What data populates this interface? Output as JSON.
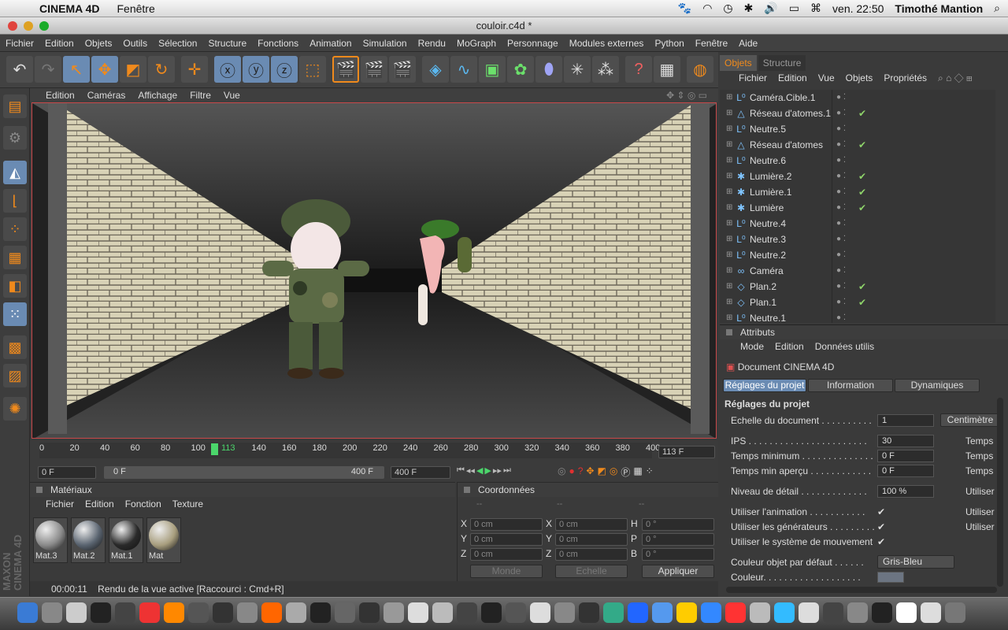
{
  "menubar": {
    "app_name": "CINEMA 4D",
    "menu": "Fenêtre",
    "time": "ven. 22:50",
    "user": "Timothé Mantion"
  },
  "window": {
    "title": "couloir.c4d *"
  },
  "main_menu": [
    "Fichier",
    "Edition",
    "Objets",
    "Outils",
    "Sélection",
    "Structure",
    "Fonctions",
    "Animation",
    "Simulation",
    "Rendu",
    "MoGraph",
    "Personnage",
    "Modules externes",
    "Python",
    "Fenêtre",
    "Aide"
  ],
  "viewport_menu": [
    "Edition",
    "Caméras",
    "Affichage",
    "Filtre",
    "Vue"
  ],
  "timeline": {
    "ticks": [
      "0",
      "20",
      "40",
      "60",
      "80",
      "100",
      "113",
      "140",
      "160",
      "180",
      "200",
      "220",
      "240",
      "260",
      "280",
      "300",
      "320",
      "340",
      "360",
      "380",
      "400"
    ],
    "current_frame": "113 F",
    "start": "0 F",
    "range_start": "0 F",
    "range_end": "400 F",
    "end": "400 F"
  },
  "materials": {
    "title": "Matériaux",
    "menu": [
      "Fichier",
      "Edition",
      "Fonction",
      "Texture"
    ],
    "items": [
      {
        "name": "Mat.3",
        "color": "#8a8a8a"
      },
      {
        "name": "Mat.2",
        "color": "#5a6470"
      },
      {
        "name": "Mat.1",
        "color": "#2a2a2a"
      },
      {
        "name": "Mat",
        "color": "#a89e7e"
      }
    ]
  },
  "coords": {
    "title": "Coordonnées",
    "col_headers": [
      "--",
      "--",
      "--"
    ],
    "rows": [
      {
        "a": "X",
        "av": "0 cm",
        "b": "X",
        "bv": "0 cm",
        "c": "H",
        "cv": "0 °"
      },
      {
        "a": "Y",
        "av": "0 cm",
        "b": "Y",
        "bv": "0 cm",
        "c": "P",
        "cv": "0 °"
      },
      {
        "a": "Z",
        "av": "0 cm",
        "b": "Z",
        "bv": "0 cm",
        "c": "B",
        "cv": "0 °"
      }
    ],
    "mode_select": "Monde",
    "scale_select": "Echelle",
    "apply": "Appliquer"
  },
  "status": {
    "time": "00:00:11",
    "message": "Rendu de la vue active [Raccourci : Cmd+R]"
  },
  "objects": {
    "tabs": [
      "Objets",
      "Structure"
    ],
    "menu": [
      "Fichier",
      "Edition",
      "Vue",
      "Objets",
      "Propriétés"
    ],
    "items": [
      {
        "label": "Caméra.Cible.1",
        "icon": "null-icon",
        "glyph": "L⁰",
        "checked": false
      },
      {
        "label": "Réseau d'atomes.1",
        "icon": "atom-array-icon",
        "glyph": "△",
        "checked": true
      },
      {
        "label": "Neutre.5",
        "icon": "null-icon",
        "glyph": "L⁰",
        "checked": false
      },
      {
        "label": "Réseau d'atomes",
        "icon": "atom-array-icon",
        "glyph": "△",
        "checked": true
      },
      {
        "label": "Neutre.6",
        "icon": "null-icon",
        "glyph": "L⁰",
        "checked": false
      },
      {
        "label": "Lumière.2",
        "icon": "light-icon",
        "glyph": "✱",
        "checked": true
      },
      {
        "label": "Lumière.1",
        "icon": "light-icon",
        "glyph": "✱",
        "checked": true
      },
      {
        "label": "Lumière",
        "icon": "light-icon",
        "glyph": "✱",
        "checked": true
      },
      {
        "label": "Neutre.4",
        "icon": "null-icon",
        "glyph": "L⁰",
        "checked": false
      },
      {
        "label": "Neutre.3",
        "icon": "null-icon",
        "glyph": "L⁰",
        "checked": false
      },
      {
        "label": "Neutre.2",
        "icon": "null-icon",
        "glyph": "L⁰",
        "checked": false
      },
      {
        "label": "Caméra",
        "icon": "camera-icon",
        "glyph": "∞",
        "checked": false
      },
      {
        "label": "Plan.2",
        "icon": "plane-icon",
        "glyph": "◇",
        "checked": true
      },
      {
        "label": "Plan.1",
        "icon": "plane-icon",
        "glyph": "◇",
        "checked": true
      },
      {
        "label": "Neutre.1",
        "icon": "null-icon",
        "glyph": "L⁰",
        "checked": false
      }
    ]
  },
  "attributes": {
    "title": "Attributs",
    "menu": [
      "Mode",
      "Edition",
      "Données utilis"
    ],
    "doc_title": "Document CINEMA 4D",
    "tabs": [
      "Réglages du projet",
      "Information",
      "Dynamiques"
    ],
    "section": "Réglages du projet",
    "fields": [
      {
        "label": "Echelle du document . . . . . . . . . .",
        "value": "1",
        "right": "Centimètre"
      },
      {
        "label": "IPS . . . . . . . . . . . . . . . . . . . . . . .",
        "value": "30",
        "right": "Temps"
      },
      {
        "label": "Temps minimum . . . . . . . . . . . . . .",
        "value": "0 F",
        "right": "Temps"
      },
      {
        "label": "Temps min aperçu . . . . . . . . . . . .",
        "value": "0 F",
        "right": "Temps"
      },
      {
        "label": "Niveau de détail . . . . . . . . . . . . .",
        "value": "100 %",
        "right": "Utiliser"
      }
    ],
    "checks": [
      {
        "label": "Utiliser l'animation . . . . . . . . . . .",
        "right": "Utiliser"
      },
      {
        "label": "Utiliser les générateurs . . . . . . . . .",
        "right": "Utiliser"
      },
      {
        "label": "Utiliser le système de mouvement",
        "right": ""
      }
    ],
    "default_color_label": "Couleur objet par défaut . . . . . .",
    "default_color_value": "Gris-Bleu",
    "color_label": "Couleur. . . . . . . . . . . . . . . . . . ."
  }
}
